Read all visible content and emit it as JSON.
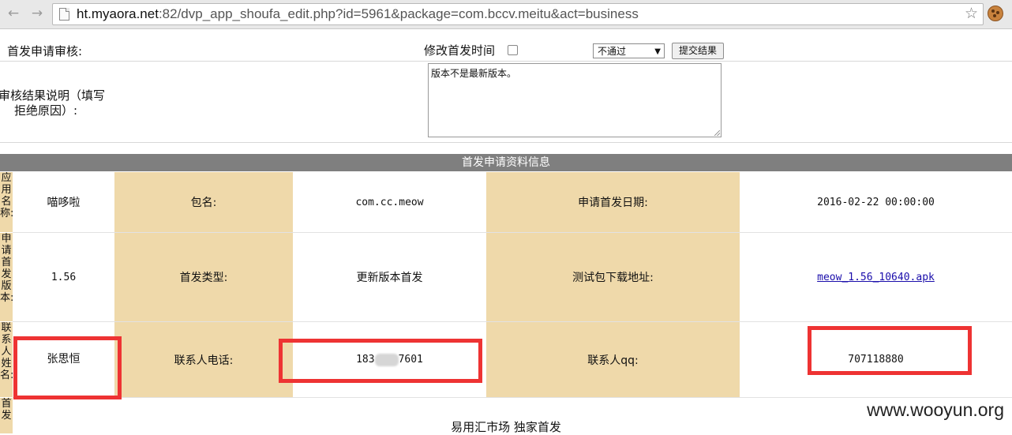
{
  "browser": {
    "url_host": "ht.myaora.net",
    "url_rest": ":82/dvp_app_shoufa_edit.php?id=5961&package=com.bccv.meitu&act=business",
    "back_icon": "arrow-left-icon",
    "forward_icon": "arrow-right-icon"
  },
  "review": {
    "label": "首发申请审核:",
    "modify_time_label": "修改首发时间",
    "select_value": "不通过",
    "submit_label": "提交结果",
    "reason_label_line1": "审核结果说明（填写",
    "reason_label_line2": "拒绝原因）:",
    "reason_text": "版本不是最新版本。"
  },
  "section_title": "首发申请资料信息",
  "rows": {
    "r1": {
      "side_label": "应用名称:",
      "value1": "喵哆啦",
      "label2": "包名:",
      "value2": "com.cc.meow",
      "label3": "申请首发日期:",
      "value3": "2016-02-22 00:00:00"
    },
    "r2": {
      "side_label": "申请首发版本:",
      "value1": "1.56",
      "label2": "首发类型:",
      "value2": "更新版本首发",
      "label3": "测试包下载地址:",
      "value3": "meow_1.56_10640.apk"
    },
    "r3": {
      "side_label": "联系人姓名:",
      "value1": "张思恒",
      "label2": "联系人电话:",
      "value2_prefix": "183",
      "value2_suffix": "7601",
      "label3": "联系人qq:",
      "value3": "707118880"
    },
    "r4": {
      "side_label": "首发",
      "value": "易用汇市场 独家首发"
    }
  },
  "watermark": "www.wooyun.org",
  "colors": {
    "label_bg": "#efd9aa",
    "header_bg": "#7f7f7f",
    "highlight": "#ee3333"
  }
}
